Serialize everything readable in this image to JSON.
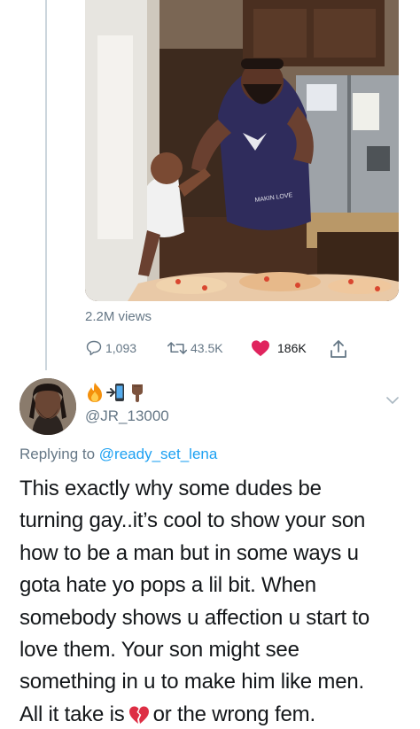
{
  "tweet": {
    "views": "2.2M views",
    "actions": {
      "replies": "1,093",
      "retweets": "43.5K",
      "likes": "186K"
    },
    "like_color": "#e0245e",
    "icons": [
      "reply-icon",
      "retweet-icon",
      "like-heart-icon",
      "share-icon"
    ],
    "media": {
      "apron_text": "MAKIN LOVE"
    }
  },
  "reply": {
    "display_name_emoji": [
      "fire",
      "mobile-phone-with-arrow",
      "index-pointing-down-dark-skin"
    ],
    "handle": "@JR_13000",
    "replying_prefix": "Replying to",
    "replying_to": "@ready_set_lena",
    "text_lines": [
      "This exactly why some dudes be",
      "turning gay..it’s cool to show your son",
      "how to be a man but in some ways u",
      "gota hate yo pops a lil bit. When",
      "somebody shows u affection u start to",
      "love them. Your son might see",
      "something in u to make him like men."
    ],
    "last_line_before": "All it take is",
    "last_line_emoji": "broken-heart",
    "last_line_after": "or the wrong fem."
  },
  "colors": {
    "text": "#14171a",
    "secondary": "#657786",
    "link": "#1da1f2"
  }
}
